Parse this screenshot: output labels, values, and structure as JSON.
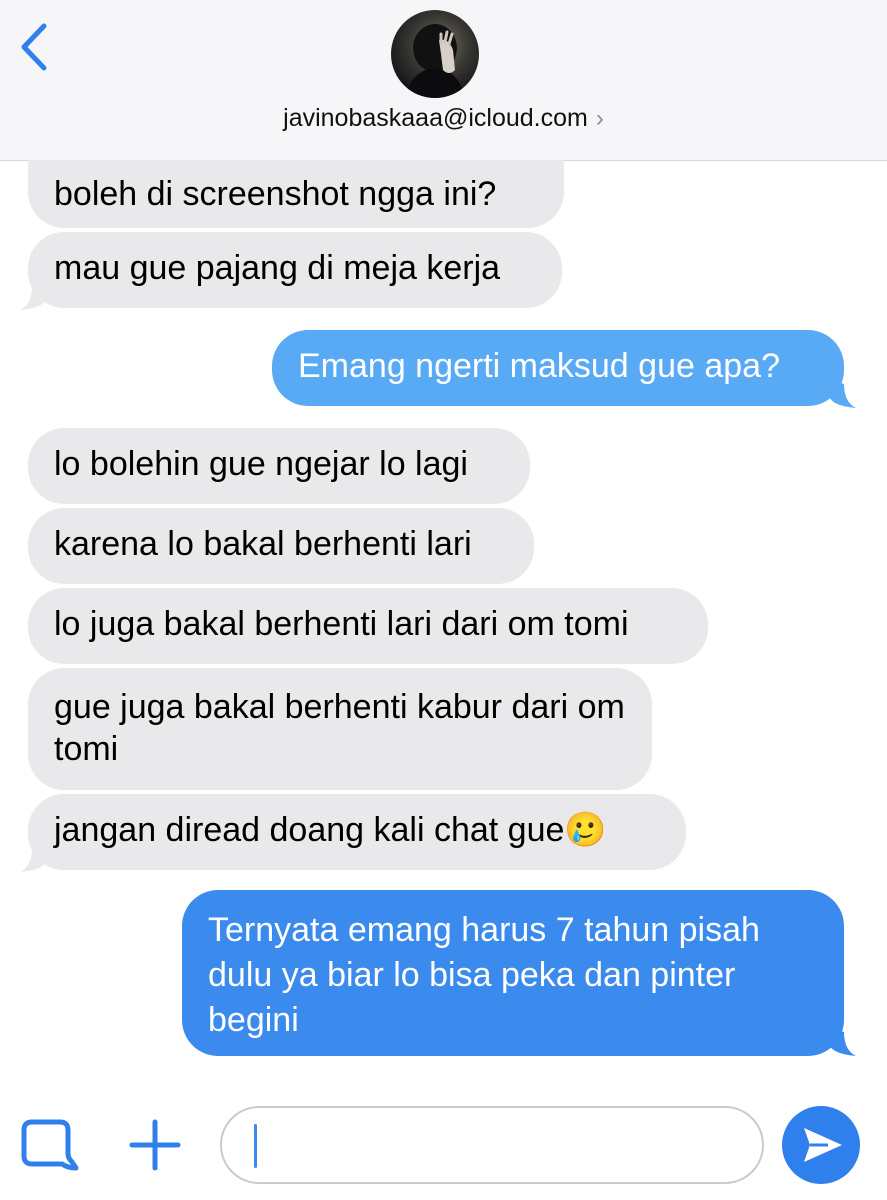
{
  "header": {
    "contact": "javinobaskaaa@icloud.com",
    "back_icon": "chevron-left-icon",
    "contact_chevron": "›"
  },
  "messages": [
    {
      "from": "them",
      "text": "boleh di screenshot ngga ini?"
    },
    {
      "from": "them",
      "text": "mau gue pajang di meja kerja"
    },
    {
      "from": "me",
      "text": "Emang ngerti maksud gue apa?"
    },
    {
      "from": "them",
      "text": "lo bolehin gue ngejar lo lagi"
    },
    {
      "from": "them",
      "text": "karena lo bakal berhenti lari"
    },
    {
      "from": "them",
      "text": "lo juga bakal berhenti lari dari om tomi"
    },
    {
      "from": "them",
      "text": "gue juga bakal berhenti kabur dari om tomi"
    },
    {
      "from": "them",
      "text": "jangan diread doang kali chat gue🥲"
    },
    {
      "from": "me",
      "text": "Ternyata emang harus 7 tahun pisah dulu ya biar lo bisa peka dan pinter begini"
    }
  ],
  "input": {
    "placeholder": "",
    "value": ""
  },
  "icons": {
    "apps": "apps-icon",
    "add": "plus-icon",
    "send": "send-icon"
  },
  "colors": {
    "incoming_bubble": "#e9e9eb",
    "outgoing_bubble_light": "#59aaf4",
    "outgoing_bubble": "#3b8aee",
    "accent": "#2f80ed"
  }
}
